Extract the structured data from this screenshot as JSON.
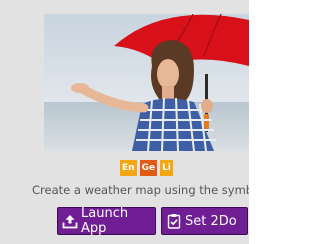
{
  "language_badges": [
    {
      "code": "En"
    },
    {
      "code": "Ge"
    },
    {
      "code": "Li"
    }
  ],
  "description": "Create a weather map using the symbols",
  "actions": {
    "launch_label": "Launch App",
    "set2do_label": "Set 2Do"
  },
  "colors": {
    "button": "#6f1e93",
    "badge_primary": "#f3a712",
    "badge_secondary": "#e35a14",
    "umbrella": "#d8101a"
  },
  "icons": {
    "launch": "upload-arrow-icon",
    "set2do": "clipboard-check-icon"
  }
}
